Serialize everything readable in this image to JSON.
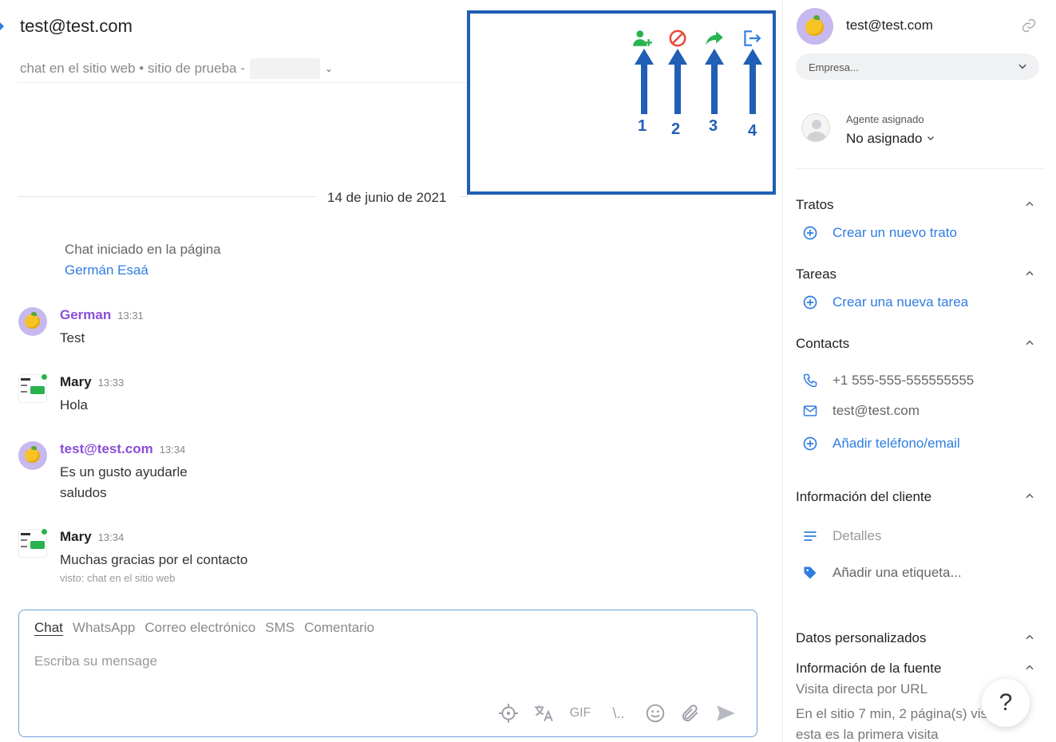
{
  "header": {
    "title": "test@test.com",
    "subtitle": "chat en el sitio web • sitio de prueba -"
  },
  "annotation": {
    "numbers": [
      "1",
      "2",
      "3",
      "4"
    ],
    "tool_icons": [
      "add-user-icon",
      "block-icon",
      "forward-icon",
      "exit-icon"
    ],
    "colors": {
      "frame": "#1f5fb5",
      "add_user": "#27b34d",
      "block": "#e74c3c",
      "forward": "#27b34d",
      "exit": "#2f7de1"
    }
  },
  "date_separator": "14 de junio de 2021",
  "chat_started": {
    "text": "Chat iniciado en la página",
    "link": "Germán Esaá"
  },
  "messages": [
    {
      "name": "German",
      "time": "13:31",
      "lines": [
        "Test"
      ],
      "avatar": "lemon",
      "name_color": "#8a4ed8"
    },
    {
      "name": "Mary",
      "time": "13:33",
      "lines": [
        "Hola"
      ],
      "avatar": "agent"
    },
    {
      "name": "test@test.com",
      "time": "13:34",
      "lines": [
        "Es un gusto ayudarle",
        "saludos"
      ],
      "avatar": "lemon",
      "name_color": "#8a4ed8"
    },
    {
      "name": "Mary",
      "time": "13:34",
      "lines": [
        "Muchas gracias por el contacto"
      ],
      "avatar": "agent",
      "seen": "visto: chat en el sitio web"
    }
  ],
  "composer": {
    "tabs": [
      "Chat",
      "WhatsApp",
      "Correo electrónico",
      "SMS",
      "Comentario"
    ],
    "active_tab": "Chat",
    "placeholder": "Escriba su mensage",
    "tools": [
      "target-icon",
      "translate-icon",
      "GIF",
      "\\..",
      "emoji-icon",
      "attach-icon",
      "send-icon"
    ]
  },
  "sidebar": {
    "email": "test@test.com",
    "company_placeholder": "Empresa...",
    "agent_label": "Agente asignado",
    "agent_value": "No asignado",
    "sections": {
      "tratos": {
        "title": "Tratos",
        "action": "Crear un nuevo trato"
      },
      "tareas": {
        "title": "Tareas",
        "action": "Crear una nueva tarea"
      },
      "contacts": {
        "title": "Contacts",
        "phone": "+1 555-555-555555555",
        "email": "test@test.com",
        "action": "Añadir teléfono/email"
      },
      "cliente": {
        "title": "Información del cliente",
        "details": "Detalles",
        "tag": "Añadir una etiqueta..."
      },
      "personalizados": {
        "title": "Datos personalizados"
      },
      "fuente": {
        "title": "Información de la fuente",
        "line1": "Visita directa por URL",
        "line2": "En el sitio 7 min, 2 página(s) vis",
        "line3": "esta es la primera visita"
      }
    }
  },
  "help_label": "?"
}
